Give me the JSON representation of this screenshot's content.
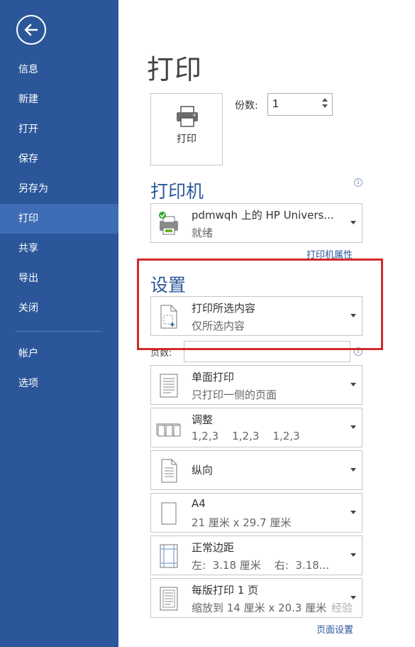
{
  "sidebar": {
    "items": [
      {
        "label": "信息"
      },
      {
        "label": "新建"
      },
      {
        "label": "打开"
      },
      {
        "label": "保存"
      },
      {
        "label": "另存为"
      },
      {
        "label": "打印"
      },
      {
        "label": "共享"
      },
      {
        "label": "导出"
      },
      {
        "label": "关闭"
      },
      {
        "label": "帐户"
      },
      {
        "label": "选项"
      }
    ],
    "active": "打印",
    "bg_color": "#2b579a"
  },
  "main": {
    "title": "打印",
    "print_button_label": "打印",
    "copies_label": "份数:",
    "copies_value": "1"
  },
  "printer": {
    "title": "打印机",
    "name": "pdmwqh 上的 HP Univers...",
    "status": "就绪",
    "properties_link": "打印机属性",
    "info_icon": "ⓘ"
  },
  "settings": {
    "title": "设置",
    "print_range": {
      "label": "打印所选内容",
      "sub": "仅所选内容"
    },
    "pages_label": "页数:",
    "pages_value": "",
    "info_icon": "ⓘ",
    "sides": {
      "label": "单面打印",
      "sub": "只打印一侧的页面"
    },
    "collate": {
      "label": "调整",
      "sub": "1,2,3    1,2,3    1,2,3"
    },
    "orientation": {
      "label": "纵向"
    },
    "paper": {
      "label": "A4",
      "sub": "21 厘米 x 29.7 厘米"
    },
    "margins": {
      "label": "正常边距",
      "sub": "左:  3.18 厘米    右:  3.18..."
    },
    "pages_per_sheet": {
      "label": "每版打印 1 页",
      "sub": "缩放到 14 厘米 x 20.3 厘米"
    },
    "page_setup_link": "页面设置"
  },
  "watermark": "经验"
}
